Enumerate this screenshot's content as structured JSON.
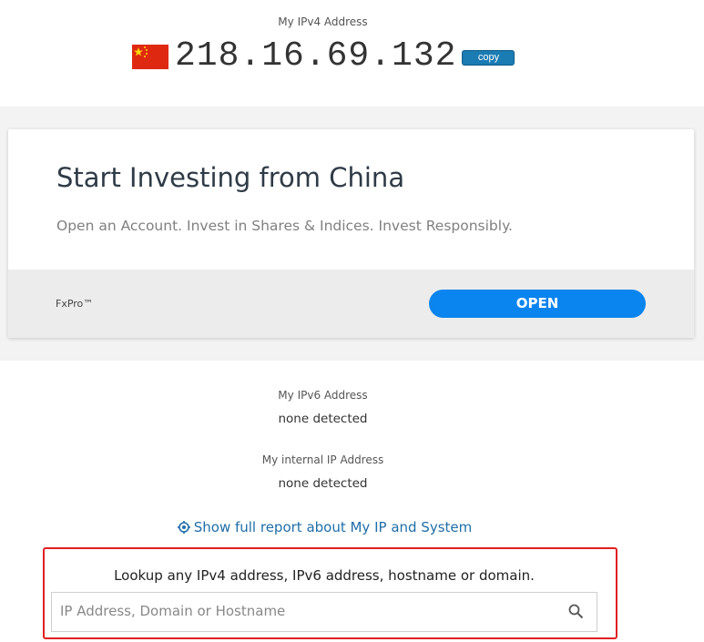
{
  "ipv4": {
    "label": "My IPv4 Address",
    "address": "218.16.69.132",
    "copy_label": "copy",
    "flag_icon": "china-flag-icon"
  },
  "ad": {
    "title": "Start Investing from China",
    "subtitle": "Open an Account. Invest in Shares & Indices. Invest Responsibly.",
    "brand": "FxPro™",
    "cta_label": "OPEN",
    "cta_color": "#0a84ef"
  },
  "ipv6": {
    "label": "My IPv6 Address",
    "value": "none detected"
  },
  "internal_ip": {
    "label": "My internal IP Address",
    "value": "none detected"
  },
  "report_link": {
    "label": "Show full report about My IP and System",
    "icon": "target-icon"
  },
  "lookup": {
    "title": "Lookup any IPv4 address, IPv6 address, hostname or domain.",
    "placeholder": "IP Address, Domain or Hostname",
    "value": "",
    "highlight_color": "#e02020",
    "search_icon": "search-icon"
  }
}
